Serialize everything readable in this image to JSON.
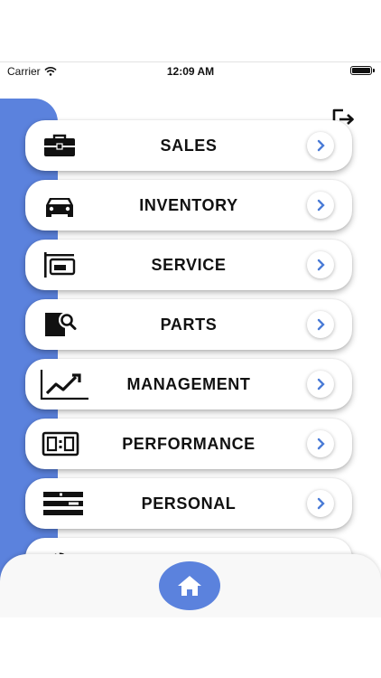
{
  "status_bar": {
    "carrier": "Carrier",
    "time": "12:09 AM"
  },
  "menu": {
    "items": [
      {
        "label": "SALES",
        "icon": "briefcase-icon"
      },
      {
        "label": "INVENTORY",
        "icon": "car-icon"
      },
      {
        "label": "SERVICE",
        "icon": "service-sign-icon"
      },
      {
        "label": "PARTS",
        "icon": "parts-search-icon"
      },
      {
        "label": "MANAGEMENT",
        "icon": "trend-chart-icon"
      },
      {
        "label": "PERFORMANCE",
        "icon": "scoreboard-icon"
      },
      {
        "label": "PERSONAL",
        "icon": "list-bars-icon"
      },
      {
        "label": "",
        "icon": "gear-icon"
      }
    ]
  },
  "colors": {
    "accent": "#5b82dd",
    "chevron": "#4a7bd6",
    "text": "#111111"
  }
}
